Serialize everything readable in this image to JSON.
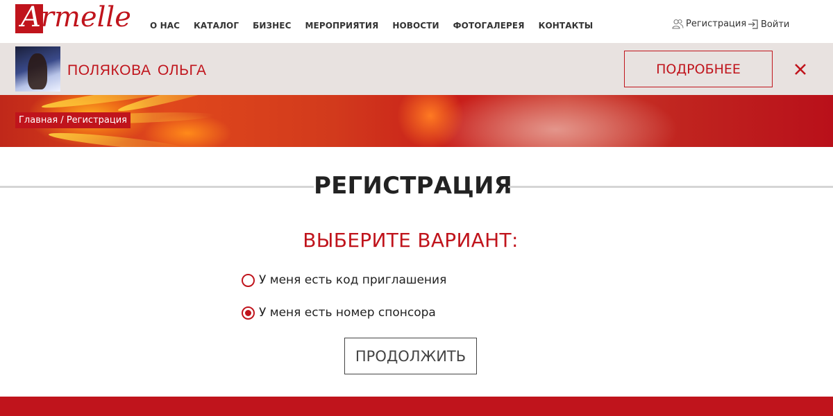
{
  "brand": {
    "logo_text": "Armelle",
    "accent_color": "#c0141c"
  },
  "nav": {
    "items": [
      "О НАС",
      "КАТАЛОГ",
      "БИЗНЕС",
      "МЕРОПРИЯТИЯ",
      "НОВОСТИ",
      "ФОТОГАЛЕРЕЯ",
      "КОНТАКТЫ"
    ]
  },
  "auth": {
    "register_label": "Регистрация",
    "login_label": "Войти"
  },
  "profile": {
    "name": "ПОЛЯКОВА ОЛЬГА",
    "more_label": "ПОДРОБНЕЕ",
    "close_icon": "close-icon"
  },
  "breadcrumb": {
    "home": "Главная",
    "separator": " / ",
    "current": "Регистрация"
  },
  "page": {
    "title": "РЕГИСТРАЦИЯ",
    "subtitle": "ВЫБЕРИТЕ ВАРИАНТ:",
    "options": [
      {
        "label": "У меня есть код приглашения",
        "checked": false
      },
      {
        "label": "У меня есть номер спонсора",
        "checked": true
      }
    ],
    "continue_label": "ПРОДОЛЖИТЬ"
  }
}
